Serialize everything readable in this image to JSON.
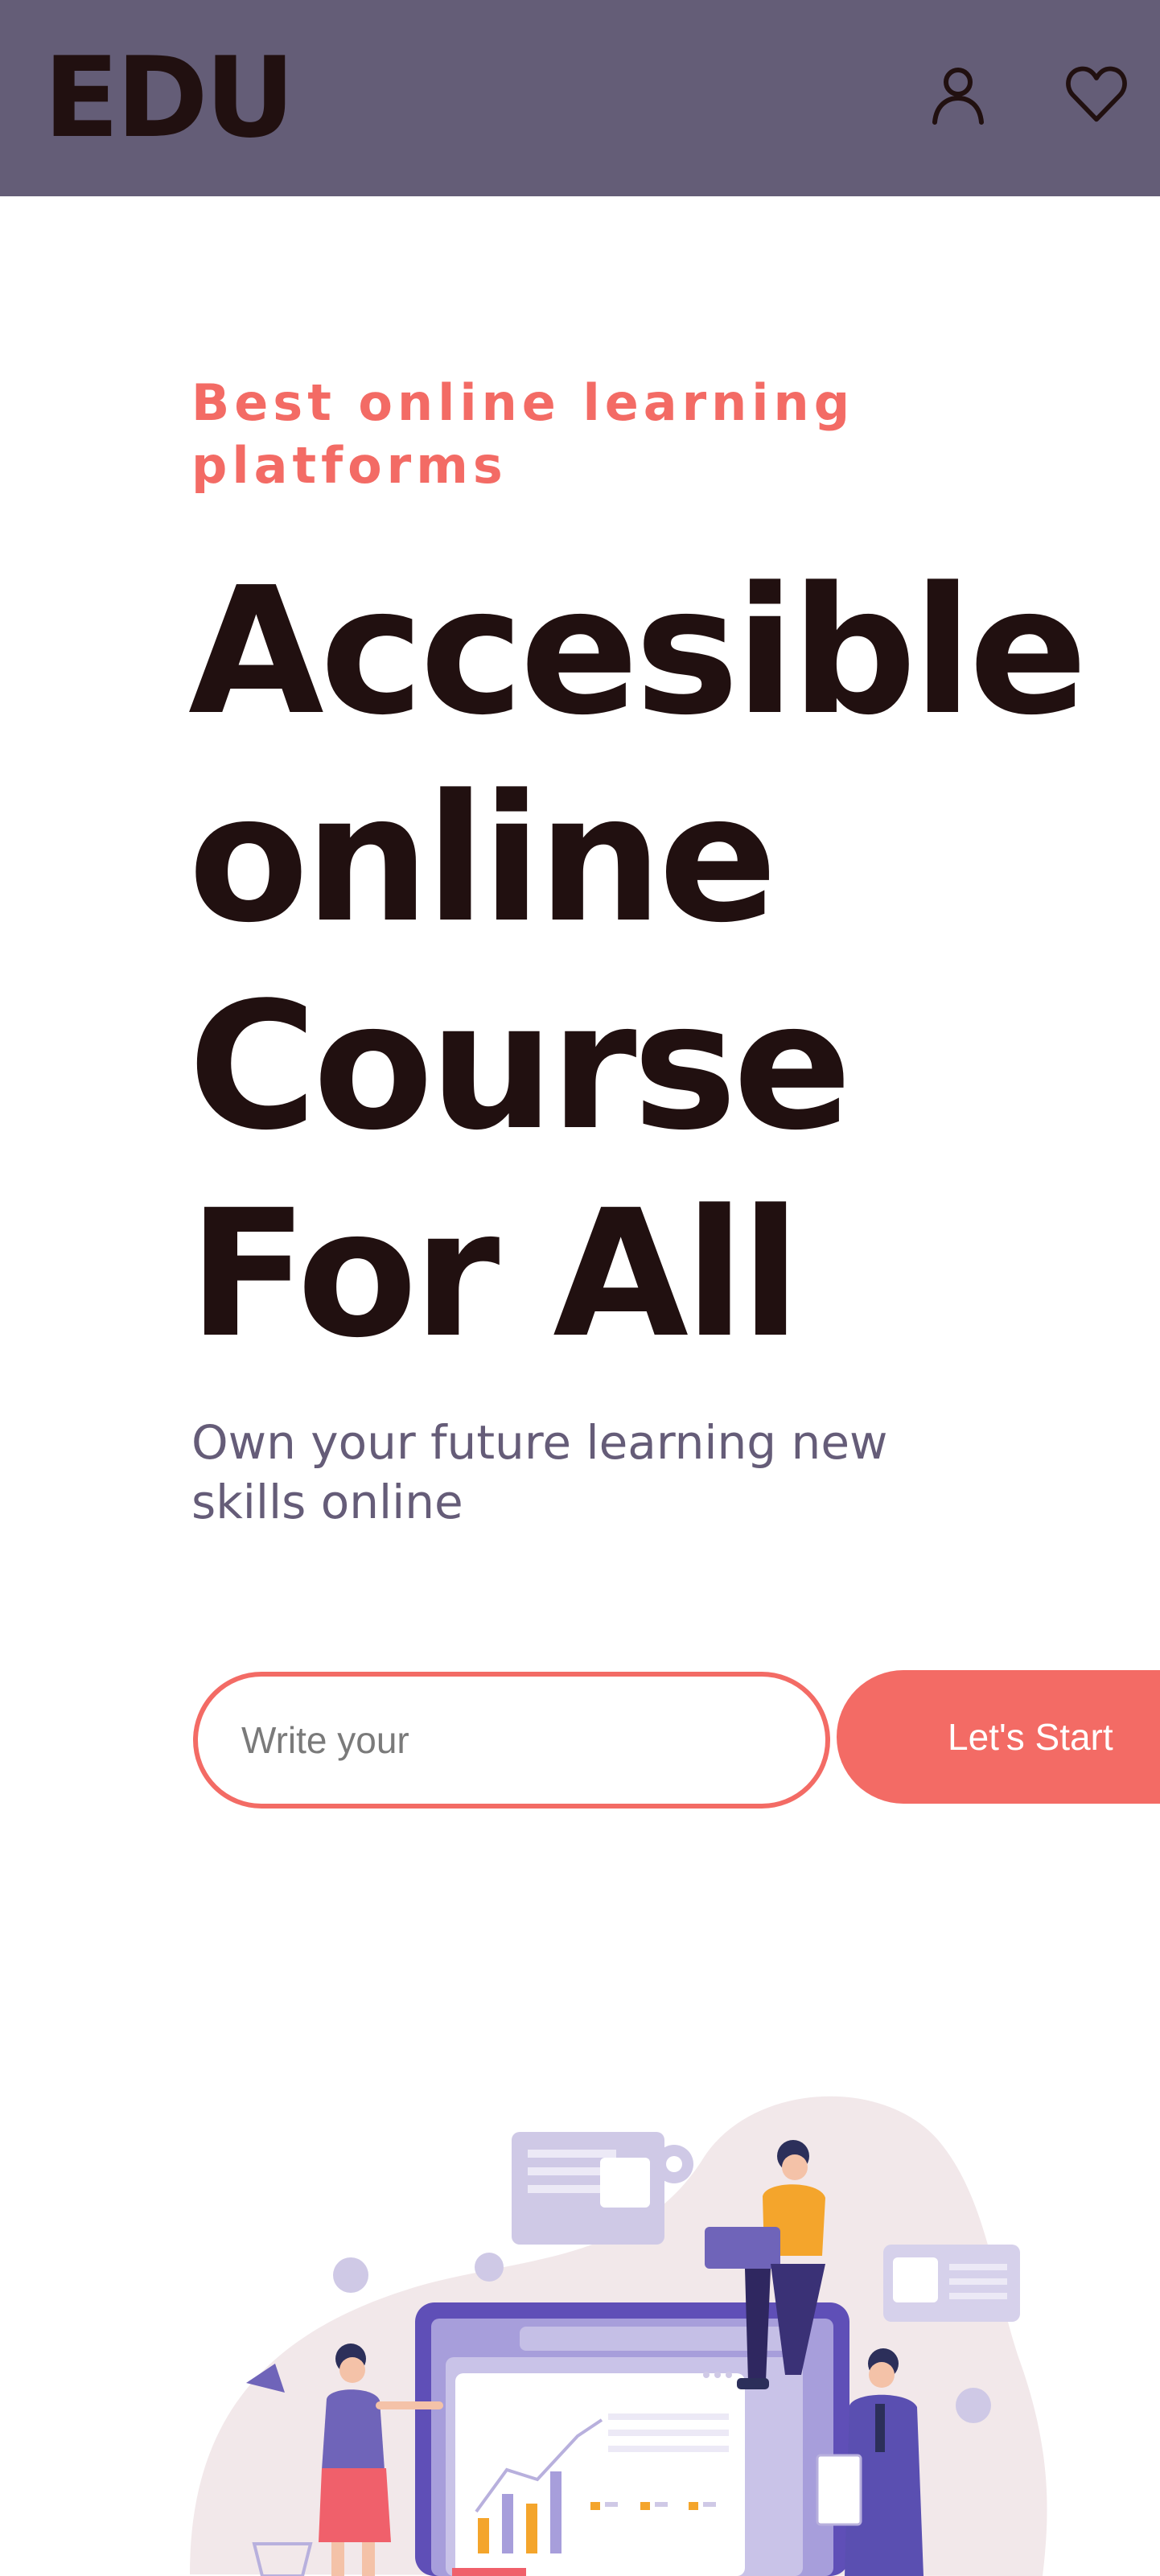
{
  "header": {
    "logo": "EDU",
    "icons": [
      "user-icon",
      "heart-icon"
    ]
  },
  "hero": {
    "eyebrow": "Best online learning platforms",
    "headline": "Accesible online Course For All",
    "subtext": "Own your future learning new skills online",
    "search": {
      "placeholder": "Write your",
      "value": ""
    },
    "cta_label": "Let's Start"
  },
  "colors": {
    "header_bg": "#645d77",
    "accent": "#f36b65",
    "heading": "#211010",
    "muted": "#655c78"
  },
  "illustration": {
    "subject": "online-learning-illustration"
  }
}
